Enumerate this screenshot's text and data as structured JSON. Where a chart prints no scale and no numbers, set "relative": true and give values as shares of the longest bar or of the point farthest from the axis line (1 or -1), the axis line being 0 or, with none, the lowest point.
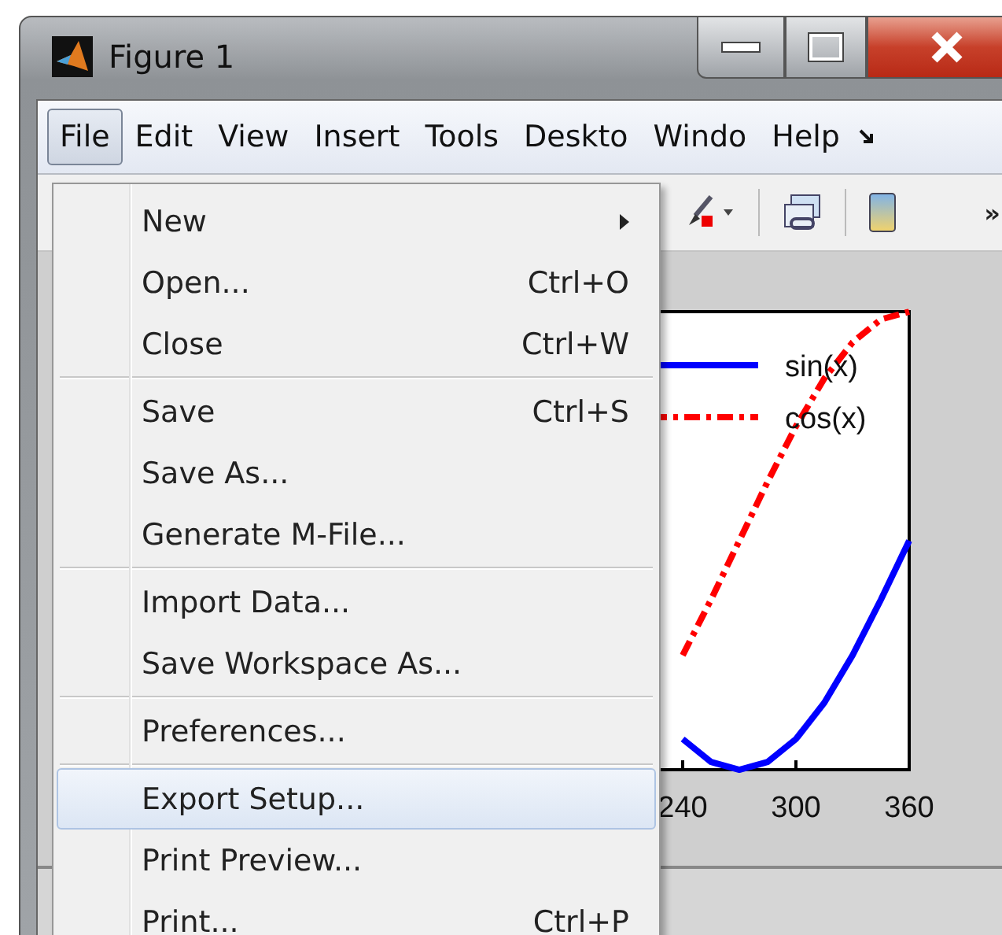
{
  "window": {
    "title": "Figure 1"
  },
  "menu_bar": [
    {
      "label": "File",
      "selected": true
    },
    {
      "label": "Edit",
      "selected": false
    },
    {
      "label": "View",
      "selected": false
    },
    {
      "label": "Insert",
      "selected": false
    },
    {
      "label": "Tools",
      "selected": false
    },
    {
      "label": "Deskto",
      "selected": false
    },
    {
      "label": "Windo",
      "selected": false
    },
    {
      "label": "Help",
      "selected": false
    }
  ],
  "toolbar": {
    "overflow": "»"
  },
  "file_menu": [
    {
      "kind": "item",
      "label": "New",
      "submenu": true,
      "selected": false
    },
    {
      "kind": "item",
      "label": "Open...",
      "shortcut": "Ctrl+O",
      "submenu": false,
      "selected": false
    },
    {
      "kind": "item",
      "label": "Close",
      "shortcut": "Ctrl+W",
      "submenu": false,
      "selected": false
    },
    {
      "kind": "separator"
    },
    {
      "kind": "item",
      "label": "Save",
      "shortcut": "Ctrl+S",
      "submenu": false,
      "selected": false
    },
    {
      "kind": "item",
      "label": "Save As...",
      "submenu": false,
      "selected": false
    },
    {
      "kind": "item",
      "label": "Generate M-File...",
      "submenu": false,
      "selected": false
    },
    {
      "kind": "separator"
    },
    {
      "kind": "item",
      "label": "Import Data...",
      "submenu": false,
      "selected": false
    },
    {
      "kind": "item",
      "label": "Save Workspace As...",
      "submenu": false,
      "selected": false
    },
    {
      "kind": "separator"
    },
    {
      "kind": "item",
      "label": "Preferences...",
      "submenu": false,
      "selected": false
    },
    {
      "kind": "separator"
    },
    {
      "kind": "item",
      "label": "Export Setup...",
      "submenu": false,
      "selected": true
    },
    {
      "kind": "item",
      "label": "Print Preview...",
      "submenu": false,
      "selected": false
    },
    {
      "kind": "item",
      "label": "Print...",
      "shortcut": "Ctrl+P",
      "submenu": false,
      "selected": false
    }
  ],
  "figure": {
    "chart_data": {
      "type": "line",
      "x": [
        240,
        255,
        270,
        285,
        300,
        315,
        330,
        345,
        360
      ],
      "series": [
        {
          "name": "sin(x)",
          "color": "#0000ff",
          "line_style": "solid",
          "values": [
            0.067,
            0.017,
            0,
            0.017,
            0.067,
            0.146,
            0.25,
            0.371,
            0.5
          ]
        },
        {
          "name": "cos(x)",
          "color": "#ff0000",
          "line_style": "dashdot",
          "values": [
            0.25,
            0.371,
            0.5,
            0.629,
            0.75,
            0.854,
            0.933,
            0.983,
            1
          ]
        }
      ],
      "xlim": [
        0,
        360
      ],
      "relative": true,
      "legend": "upper right",
      "xticks": [
        240,
        300,
        360
      ]
    }
  }
}
